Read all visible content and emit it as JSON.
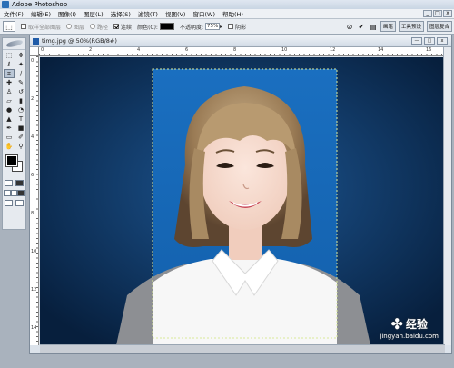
{
  "app": {
    "title": "Adobe Photoshop"
  },
  "menu": {
    "items": [
      "文件(F)",
      "编辑(E)",
      "图像(I)",
      "图层(L)",
      "选择(S)",
      "滤镜(T)",
      "视图(V)",
      "窗口(W)",
      "帮助(H)"
    ],
    "ad_label": "···",
    "window_buttons": [
      "_",
      "□",
      "x"
    ]
  },
  "options": {
    "sample_all_layers": "取样全部图层",
    "all_layers_label": "图层",
    "shape_label": "路径",
    "contiguous": "连续",
    "color_label": "颜色(C):",
    "opacity_label": "不透明度:",
    "opacity_value": "75%",
    "shadow": "阴影",
    "tabs": [
      "画笔",
      "工具预设",
      "图层复合"
    ]
  },
  "document": {
    "title": "timg.jpg @ 50%(RGB/8#)",
    "ruler_h": [
      "0",
      "2",
      "4",
      "6",
      "8",
      "10",
      "12",
      "14",
      "16"
    ],
    "ruler_v": [
      "0",
      "2",
      "4",
      "6",
      "8",
      "10",
      "12",
      "14"
    ],
    "buttons": [
      "—",
      "□",
      "x"
    ]
  },
  "watermark": {
    "brand": "经验",
    "url": "jingyan.baidu.com"
  },
  "colors": {
    "photo_bg": "#1a6fc0",
    "canvas_dark": "#0a2b50",
    "foreground": "#000000",
    "background": "#ffffff"
  }
}
